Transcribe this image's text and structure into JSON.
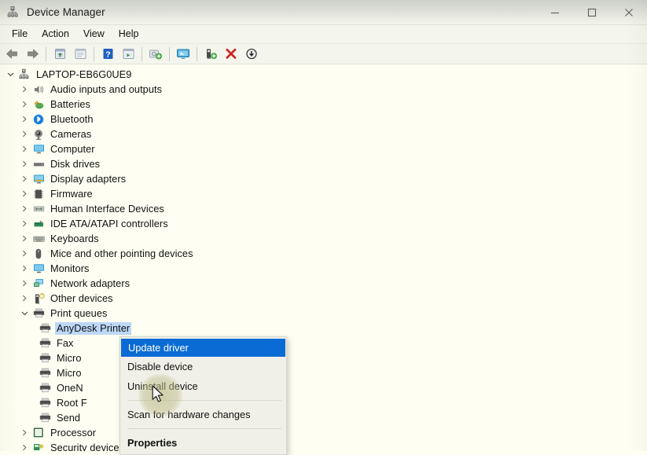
{
  "window": {
    "title": "Device Manager",
    "title_icon": "device-manager-icon",
    "controls": [
      {
        "name": "minimize",
        "glyph": "minimize-icon"
      },
      {
        "name": "maximize",
        "glyph": "maximize-icon"
      },
      {
        "name": "close",
        "glyph": "close-icon"
      }
    ]
  },
  "menubar": {
    "items": [
      {
        "label": "File",
        "accel": "F"
      },
      {
        "label": "Action",
        "accel": "A"
      },
      {
        "label": "View",
        "accel": "V"
      },
      {
        "label": "Help",
        "accel": "H"
      }
    ]
  },
  "toolbar": {
    "buttons": [
      {
        "name": "back-button",
        "icon": "back-arrow-icon",
        "tip": "Back"
      },
      {
        "name": "forward-button",
        "icon": "forward-arrow-icon",
        "tip": "Forward"
      },
      {
        "name": "up-one-level-button",
        "icon": "folder-up-icon",
        "tip": "Up one level"
      },
      {
        "name": "show-hide-console-tree-button",
        "icon": "console-tree-icon",
        "tip": "Show/Hide Console Tree"
      },
      {
        "name": "help-button",
        "icon": "help-question-icon",
        "tip": "Help"
      },
      {
        "name": "properties-button",
        "icon": "properties-window-icon",
        "tip": "Properties"
      },
      {
        "name": "update-driver-button",
        "icon": "update-driver-icon",
        "tip": "Update driver"
      },
      {
        "name": "scan-hardware-changes-button",
        "icon": "scan-monitor-icon",
        "tip": "Scan for hardware changes"
      },
      {
        "name": "enable-device-button",
        "icon": "enable-device-icon",
        "tip": "Enable device"
      },
      {
        "name": "uninstall-device-button",
        "icon": "red-x-icon",
        "tip": "Uninstall device"
      },
      {
        "name": "disable-device-button",
        "icon": "disable-device-icon",
        "tip": "Disable device"
      }
    ],
    "separators_after": [
      1,
      5,
      6,
      7
    ]
  },
  "tree": {
    "root": {
      "label": "LAPTOP-EB6G0UE9",
      "icon": "computer-root-icon",
      "expanded": true
    },
    "items": [
      {
        "label": "Audio inputs and outputs",
        "icon": "speaker-icon",
        "expanded": false,
        "level": 1
      },
      {
        "label": "Batteries",
        "icon": "battery-icon",
        "expanded": false,
        "level": 1
      },
      {
        "label": "Bluetooth",
        "icon": "bluetooth-icon",
        "expanded": false,
        "level": 1
      },
      {
        "label": "Cameras",
        "icon": "camera-icon",
        "expanded": false,
        "level": 1
      },
      {
        "label": "Computer",
        "icon": "monitor-icon",
        "expanded": false,
        "level": 1
      },
      {
        "label": "Disk drives",
        "icon": "disk-drive-icon",
        "expanded": false,
        "level": 1
      },
      {
        "label": "Display adapters",
        "icon": "display-adapter-icon",
        "expanded": false,
        "level": 1
      },
      {
        "label": "Firmware",
        "icon": "firmware-chip-icon",
        "expanded": false,
        "level": 1
      },
      {
        "label": "Human Interface Devices",
        "icon": "hid-icon",
        "expanded": false,
        "level": 1
      },
      {
        "label": "IDE ATA/ATAPI controllers",
        "icon": "ide-controller-icon",
        "expanded": false,
        "level": 1
      },
      {
        "label": "Keyboards",
        "icon": "keyboard-icon",
        "expanded": false,
        "level": 1
      },
      {
        "label": "Mice and other pointing devices",
        "icon": "mouse-icon",
        "expanded": false,
        "level": 1
      },
      {
        "label": "Monitors",
        "icon": "monitor-icon",
        "expanded": false,
        "level": 1
      },
      {
        "label": "Network adapters",
        "icon": "network-adapter-icon",
        "expanded": false,
        "level": 1
      },
      {
        "label": "Other devices",
        "icon": "other-device-icon",
        "expanded": false,
        "level": 1
      },
      {
        "label": "Print queues",
        "icon": "printer-icon",
        "expanded": true,
        "level": 1
      },
      {
        "label": "AnyDesk Printer",
        "icon": "printer-icon",
        "level": 2,
        "selected": true
      },
      {
        "label": "Fax",
        "icon": "printer-icon",
        "level": 2
      },
      {
        "label": "Micro",
        "icon": "printer-icon",
        "level": 2,
        "truncated": true
      },
      {
        "label": "Micro",
        "icon": "printer-icon",
        "level": 2,
        "truncated": true
      },
      {
        "label": "OneN",
        "icon": "printer-icon",
        "level": 2,
        "truncated": true
      },
      {
        "label": "Root F",
        "icon": "printer-icon",
        "level": 2,
        "truncated": true
      },
      {
        "label": "Send ",
        "icon": "printer-icon",
        "level": 2,
        "truncated": true
      },
      {
        "label": "Processor",
        "icon": "processor-icon",
        "expanded": false,
        "level": 1
      },
      {
        "label": "Security devices",
        "icon": "security-device-icon",
        "expanded": false,
        "level": 1
      }
    ]
  },
  "context_menu": {
    "items": [
      {
        "label": "Update driver",
        "accel": "p",
        "state": "highlighted"
      },
      {
        "label": "Disable device",
        "accel": "D",
        "state": "normal"
      },
      {
        "label": "Uninstall device",
        "accel": "U",
        "state": "normal"
      },
      {
        "type": "separator"
      },
      {
        "label": "Scan for hardware changes",
        "accel": "S",
        "state": "normal"
      },
      {
        "type": "separator"
      },
      {
        "label": "Properties",
        "accel": "r",
        "state": "normal",
        "bold": true
      }
    ]
  },
  "colors": {
    "selection_blue": "#0a6bd4",
    "tree_selection": "#bdd7f7",
    "content_bg": "#fefff2",
    "chrome_bg": "#f4f5ec",
    "uninstall_red": "#cc2222"
  }
}
